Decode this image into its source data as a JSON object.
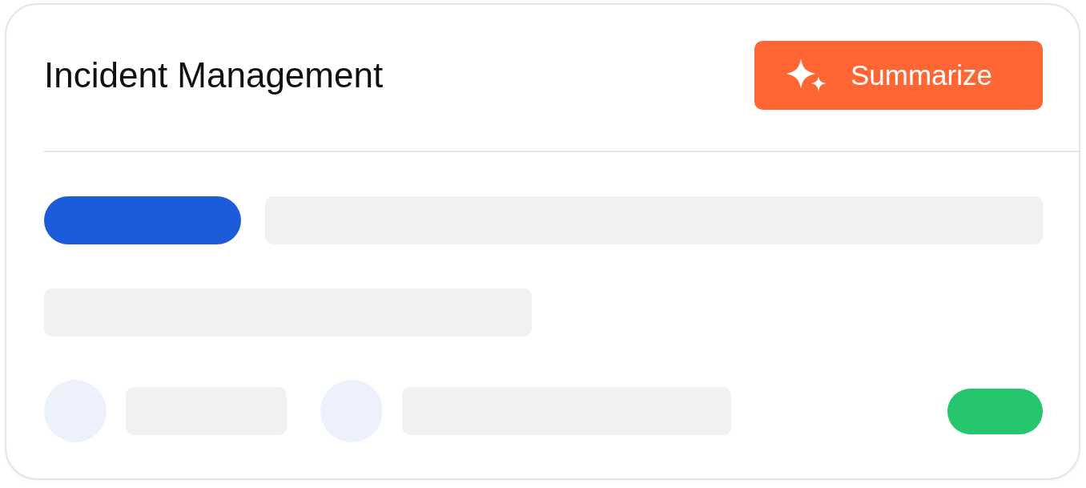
{
  "card": {
    "title": "Incident Management",
    "summarize_button": {
      "label": "Summarize"
    }
  }
}
